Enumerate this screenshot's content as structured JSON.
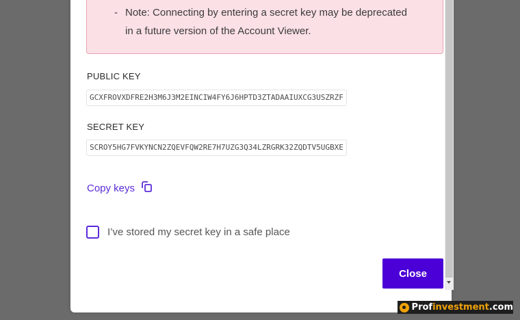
{
  "warning": {
    "note_line1": "Note: Connecting by entering a secret key may be deprecated",
    "note_line2": "in a future version of the Account Viewer.",
    "dash": "-"
  },
  "public_key": {
    "label": "PUBLIC KEY",
    "value": "GCXFROVXDFRE2H3M6J3M2EINCIW4FY6J6HPTD3ZTADAAIUXCG3USZRZF"
  },
  "secret_key": {
    "label": "SECRET KEY",
    "value": "SCROY5HG7FVKYNCN2ZQEVFQW2RE7H7UZG3Q34LZRGRK32ZQDTV5UGBXE"
  },
  "copy_keys": {
    "label": "Copy keys",
    "icon": "copy-icon"
  },
  "checkbox": {
    "label": "I’ve stored my secret key in a safe place",
    "checked": false
  },
  "close_button": {
    "label": "Close"
  },
  "watermark": {
    "prefix": "Prof",
    "middle": "investment",
    "suffix": ".com"
  },
  "colors": {
    "accent": "#5b2bd8",
    "button": "#4a00d6",
    "warning_bg": "#fbe0e6",
    "overlay": "#6b6b6b"
  }
}
